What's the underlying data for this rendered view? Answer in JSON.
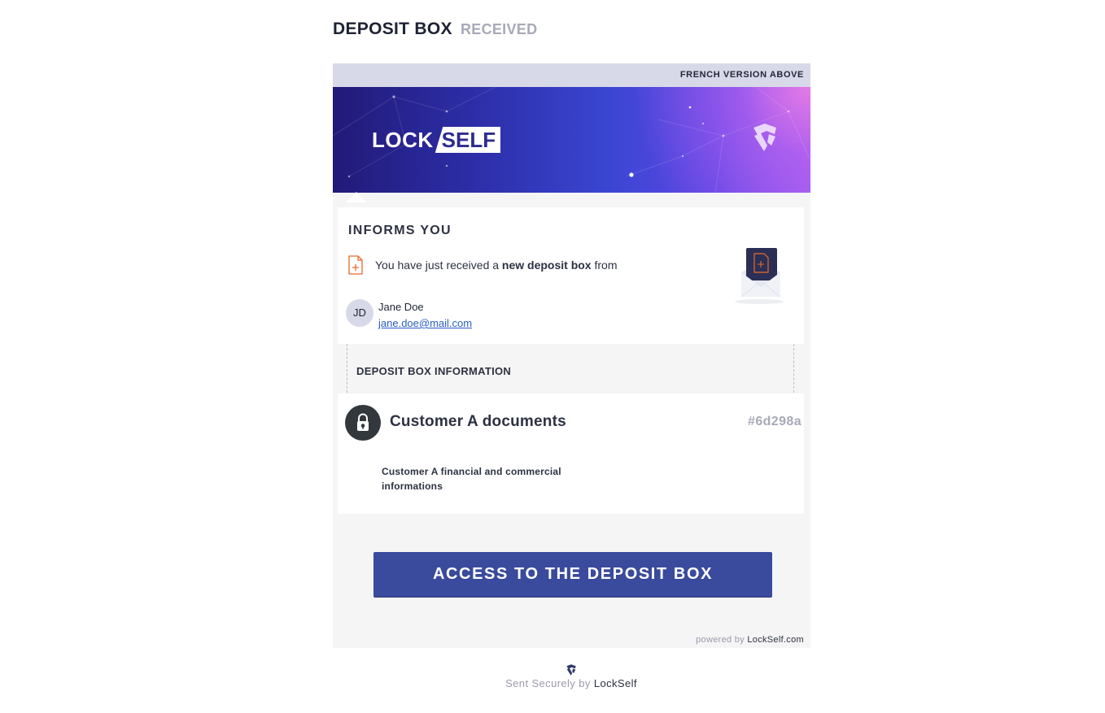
{
  "page": {
    "heading": "DEPOSIT BOX",
    "heading_status": "RECEIVED"
  },
  "email": {
    "top_bar": "FRENCH VERSION ABOVE",
    "banner": {
      "logo_part1": "LOCK",
      "logo_part2": "SELF"
    },
    "informs": {
      "title": "INFORMS YOU",
      "line_prefix": "You have just received a",
      "line_bold": "new deposit box",
      "line_suffix": "from"
    },
    "sender": {
      "initials": "JD",
      "name": "Jane Doe",
      "email": "jane.doe@mail.com"
    },
    "section_label": "DEPOSIT BOX INFORMATION",
    "deposit_box": {
      "title": "Customer A documents",
      "id": "#6d298a",
      "description": "Customer A financial and commercial informations"
    },
    "cta_label": "ACCESS TO THE DEPOSIT BOX",
    "powered_prefix": "powered by",
    "powered_brand": "LockSelf.com"
  },
  "footer": {
    "prefix": "Sent Securely by",
    "brand": "LockSelf"
  },
  "colors": {
    "cta_background": "#3a4a9c",
    "top_bar_background": "#d8d9e8",
    "link": "#2a5ec4",
    "doc_icon": "#e86a2b"
  },
  "icons": {
    "document": "document-plus-icon",
    "envelope": "envelope-illustration",
    "lock": "lock-icon",
    "shield": "lockself-shield-icon"
  }
}
